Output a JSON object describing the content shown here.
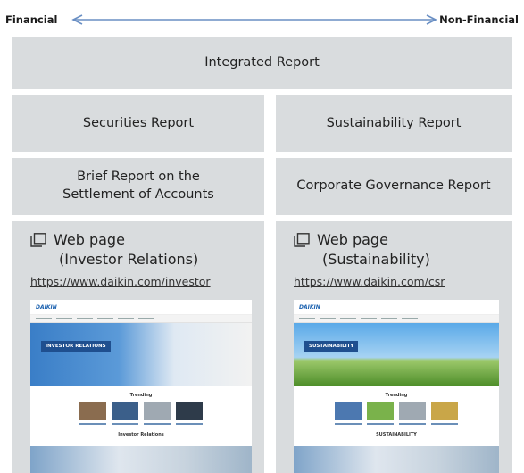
{
  "axis": {
    "left_label": "Financial",
    "right_label": "Non-Financial"
  },
  "reports": {
    "integrated": "Integrated Report",
    "securities": "Securities Report",
    "sustainability": "Sustainability Report",
    "brief_line1": "Brief Report on the",
    "brief_line2": "Settlement of Accounts",
    "governance": "Corporate Governance Report"
  },
  "web_ir": {
    "title": "Web page",
    "subtitle": "(Investor Relations)",
    "url": "https://www.daikin.com/investor",
    "thumb_logo": "DAIKIN",
    "thumb_badge": "INVESTOR RELATIONS",
    "thumb_section": "Trending",
    "thumb_section2": "Investor Relations"
  },
  "web_csr": {
    "title": "Web page",
    "subtitle": "(Sustainability)",
    "url": "https://www.daikin.com/csr",
    "thumb_logo": "DAIKIN",
    "thumb_badge": "SUSTAINABILITY",
    "thumb_section": "Trending",
    "thumb_section2": "SUSTAINABILITY"
  },
  "colors": {
    "box_bg": "#d9dcde",
    "arrow": "#6a8fc4"
  }
}
